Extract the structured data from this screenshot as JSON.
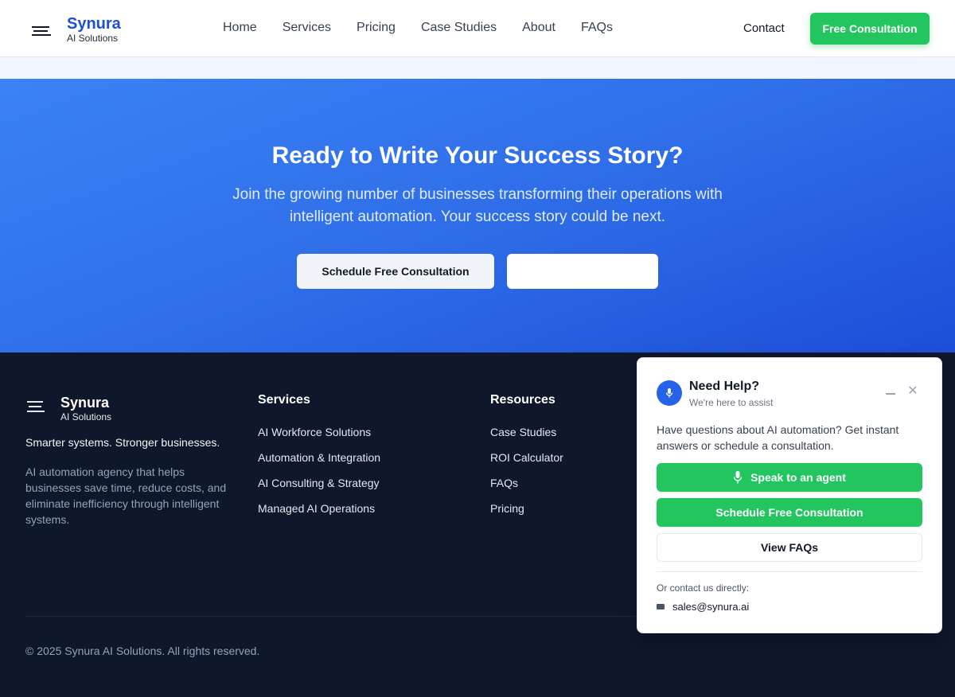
{
  "header": {
    "brand_name": "Synura",
    "brand_sub": "AI Solutions",
    "nav": [
      "Home",
      "Services",
      "Pricing",
      "Case Studies",
      "About",
      "FAQs"
    ],
    "contact": "Contact",
    "cta": "Free Consultation"
  },
  "hero": {
    "title": "Ready to Write Your Success Story?",
    "text": "Join the growing number of businesses transforming their operations with intelligent automation. Your success story could be next.",
    "primary_button": "Schedule Free Consultation",
    "secondary_button": ""
  },
  "footer": {
    "brand_name": "Synura",
    "brand_sub": "AI Solutions",
    "tagline": "Smarter systems. Stronger businesses.",
    "description": "AI automation agency that helps businesses save time, reduce costs, and eliminate inefficiency through intelligent systems.",
    "services_heading": "Services",
    "services": [
      "AI Workforce Solutions",
      "Automation & Integration",
      "AI Consulting & Strategy",
      "Managed AI Operations"
    ],
    "resources_heading": "Resources",
    "resources": [
      "Case Studies",
      "ROI Calculator",
      "FAQs",
      "Pricing"
    ],
    "copyright": "© 2025 Synura AI Solutions. All rights reserved."
  },
  "widget": {
    "title": "Need Help?",
    "subtitle": "We're here to assist",
    "text": "Have questions about AI automation? Get instant answers or schedule a consultation.",
    "speak_button": "Speak to an agent",
    "schedule_button": "Schedule Free Consultation",
    "faq_button": "View FAQs",
    "direct_label": "Or contact us directly:",
    "email": "sales@synura.ai"
  },
  "colors": {
    "brand_blue": "#1d4ed8",
    "accent_green": "#22c55e",
    "footer_bg": "#0f172a"
  },
  "icons": [
    "logo-mark-icon",
    "mic-icon",
    "minimize-icon",
    "close-icon",
    "mail-icon"
  ]
}
